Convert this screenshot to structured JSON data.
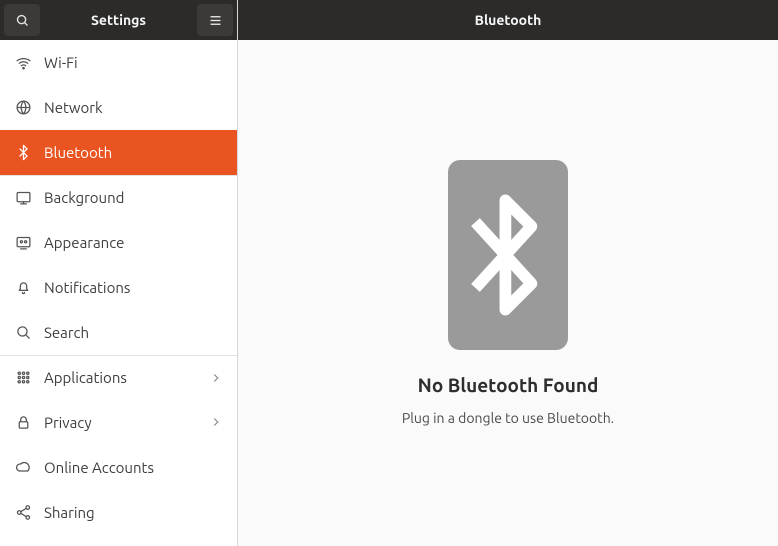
{
  "sidebar": {
    "title": "Settings",
    "items": [
      {
        "id": "wifi",
        "label": "Wi-Fi",
        "selected": false,
        "hasChevron": false,
        "groupTop": false
      },
      {
        "id": "network",
        "label": "Network",
        "selected": false,
        "hasChevron": false,
        "groupTop": false
      },
      {
        "id": "bluetooth",
        "label": "Bluetooth",
        "selected": true,
        "hasChevron": false,
        "groupTop": false
      },
      {
        "id": "background",
        "label": "Background",
        "selected": false,
        "hasChevron": false,
        "groupTop": true
      },
      {
        "id": "appearance",
        "label": "Appearance",
        "selected": false,
        "hasChevron": false,
        "groupTop": false
      },
      {
        "id": "notifications",
        "label": "Notifications",
        "selected": false,
        "hasChevron": false,
        "groupTop": false
      },
      {
        "id": "search",
        "label": "Search",
        "selected": false,
        "hasChevron": false,
        "groupTop": false
      },
      {
        "id": "applications",
        "label": "Applications",
        "selected": false,
        "hasChevron": true,
        "groupTop": true
      },
      {
        "id": "privacy",
        "label": "Privacy",
        "selected": false,
        "hasChevron": true,
        "groupTop": false
      },
      {
        "id": "online-accounts",
        "label": "Online Accounts",
        "selected": false,
        "hasChevron": false,
        "groupTop": false
      },
      {
        "id": "sharing",
        "label": "Sharing",
        "selected": false,
        "hasChevron": false,
        "groupTop": false
      }
    ]
  },
  "content": {
    "title": "Bluetooth",
    "status_title": "No Bluetooth Found",
    "status_subtitle": "Plug in a dongle to use Bluetooth."
  },
  "colors": {
    "accent": "#e95420",
    "header_bg": "#2c2b29"
  }
}
